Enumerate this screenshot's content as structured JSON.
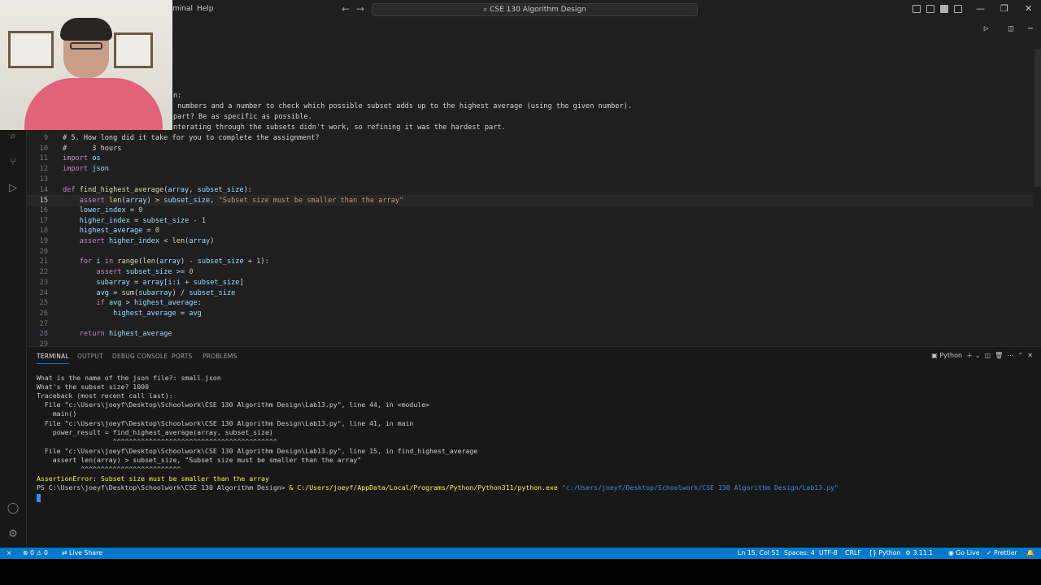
{
  "titlebar": {
    "menu": [
      "minal",
      "Help"
    ],
    "command_center": "CSE 130 Algorithm Design"
  },
  "activity_icons": [
    "search-icon",
    "source-control-icon",
    "run-debug-icon",
    "testing-icon",
    "account-icon",
    "settings-gear-icon"
  ],
  "editor": {
    "partial_lines": [
      {
        "text": "n:"
      },
      {
        "text": " numbers and a number to check which possible subset adds up to the highest average (using the given number)."
      },
      {
        "text": "part? Be as specific as possible."
      },
      {
        "text": "nterating through the subsets didn't work, so refining it was the hardest part."
      }
    ],
    "lines": [
      {
        "n": "9",
        "text": "# 5. How long did it take for you to complete the assignment?"
      },
      {
        "n": "10",
        "text": "#      3 hours"
      },
      {
        "n": "11",
        "text": "import os"
      },
      {
        "n": "12",
        "text": "import json"
      },
      {
        "n": "13",
        "text": ""
      },
      {
        "n": "14",
        "text": "def find_highest_average(array, subset_size):"
      },
      {
        "n": "15",
        "text": "    assert len(array) > subset_size, \"Subset size must be smaller than the array\""
      },
      {
        "n": "16",
        "text": "    lower_index = 0"
      },
      {
        "n": "17",
        "text": "    higher_index = subset_size - 1"
      },
      {
        "n": "18",
        "text": "    highest_average = 0"
      },
      {
        "n": "19",
        "text": "    assert higher_index < len(array)"
      },
      {
        "n": "20",
        "text": ""
      },
      {
        "n": "21",
        "text": "    for i in range(len(array) - subset_size + 1):"
      },
      {
        "n": "22",
        "text": "        assert subset_size >= 0"
      },
      {
        "n": "23",
        "text": "        subarray = array[i:i + subset_size]"
      },
      {
        "n": "24",
        "text": "        avg = sum(subarray) / subset_size"
      },
      {
        "n": "25",
        "text": "        if avg > highest_average:"
      },
      {
        "n": "26",
        "text": "            highest_average = avg"
      },
      {
        "n": "27",
        "text": ""
      },
      {
        "n": "28",
        "text": "    return highest_average"
      },
      {
        "n": "29",
        "text": ""
      }
    ]
  },
  "panel": {
    "tabs": [
      "TERMINAL",
      "OUTPUT",
      "DEBUG CONSOLE",
      "PORTS",
      "PROBLEMS"
    ],
    "terminal_profile": "Python",
    "terminal": [
      "What is the name of the json file?: small.json",
      "What's the subset size? 1000",
      "Traceback (most recent call last):",
      "  File \"c:\\Users\\joeyf\\Desktop\\Schoolwork\\CSE 130 Algorithm Design\\Lab13.py\", line 44, in <module>",
      "    main()",
      "  File \"c:\\Users\\joeyf\\Desktop\\Schoolwork\\CSE 130 Algorithm Design\\Lab13.py\", line 41, in main",
      "    power_result = find_highest_average(array, subset_size)",
      "                   ^^^^^^^^^^^^^^^^^^^^^^^^^^^^^^^^^^^^^^^^^",
      "  File \"c:\\Users\\joeyf\\Desktop\\Schoolwork\\CSE 130 Algorithm Design\\Lab13.py\", line 15, in find_highest_average",
      "    assert len(array) > subset_size, \"Subset size must be smaller than the array\"",
      "           ^^^^^^^^^^^^^^^^^^^^^^^^^",
      "AssertionError: Subset size must be smaller than the array"
    ],
    "prompt_path": "PS C:\\Users\\joeyf\\Desktop\\Schoolwork\\CSE 130 Algorithm Design> ",
    "prompt_cmd": "& C:/Users/joeyf/AppData/Local/Programs/Python/Python311/python.exe",
    "prompt_arg": " \"c:/Users/joeyf/Desktop/Schoolwork/CSE 130 Algorithm Design/Lab13.py\""
  },
  "statusbar": {
    "errors": "0",
    "warnings": "0",
    "live_share": "Live Share",
    "position": "Ln 15, Col 51",
    "spaces": "Spaces: 4",
    "encoding": "UTF-8",
    "eol": "CRLF",
    "language": "Python",
    "interpreter": "3.11.1",
    "go_live": "Go Live",
    "prettier": "Prettier"
  },
  "colors": {
    "statusbar": "#007acc",
    "accent": "#0078d4"
  }
}
